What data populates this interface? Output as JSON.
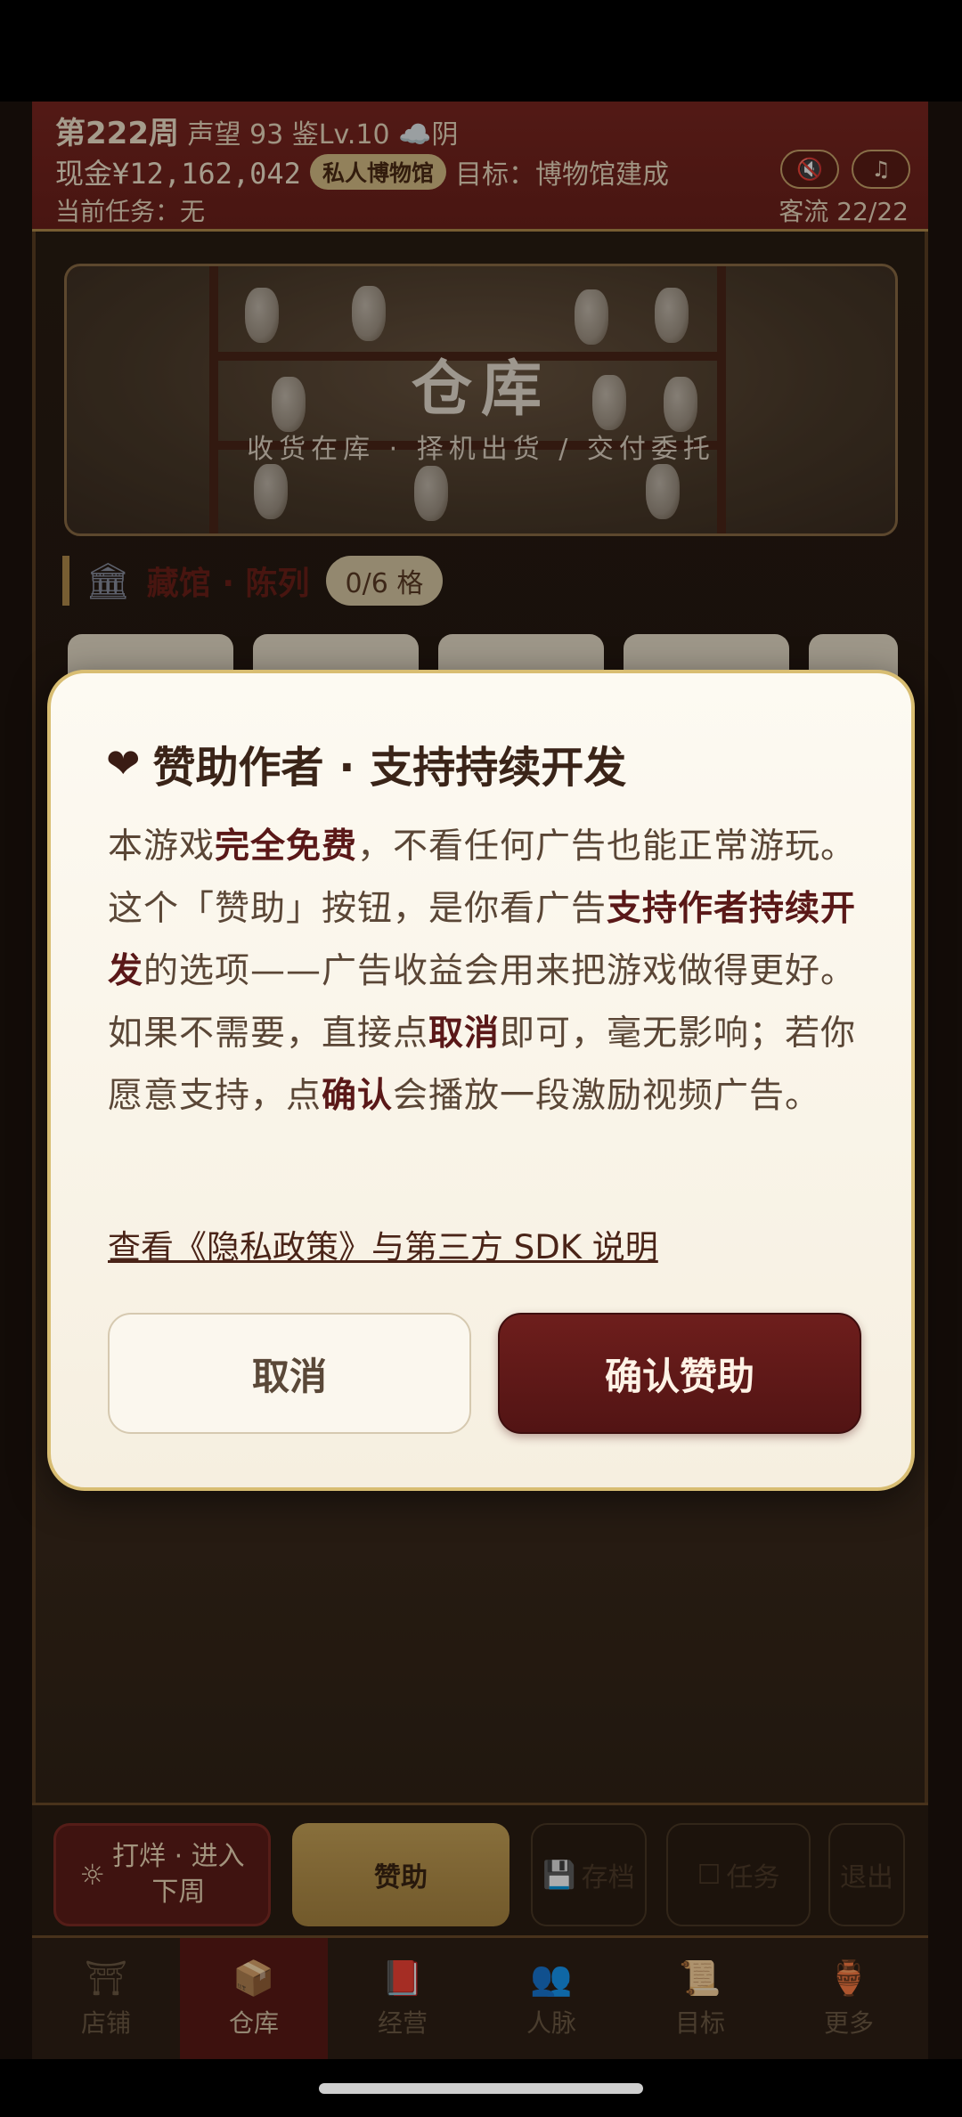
{
  "hud": {
    "week": "第222周",
    "prestige": "声望 93",
    "appraisal_level": "鉴Lv.10",
    "weather": "☁️阴",
    "cash": "现金¥12,162,042",
    "museum_badge": "私人博物馆",
    "goal": "目标：博物馆建成",
    "task": "当前任务：无",
    "visitors": "客流 22/22",
    "mute_icon": "speaker-mute-icon",
    "music_icon": "music-note-icon"
  },
  "banner": {
    "title": "仓库",
    "subtitle": "收货在库 · 择机出货 / 交付委托"
  },
  "section": {
    "title": "藏馆 · 陈列",
    "slots": "0/6 格"
  },
  "modal": {
    "title": "赞助作者 · 支持持续开发",
    "body": [
      {
        "t": "本游戏",
        "b": false
      },
      {
        "t": "完全免费",
        "b": true
      },
      {
        "t": "，不看任何广告也能正常游玩。这个「赞助」按钮，是你看广告",
        "b": false
      },
      {
        "t": "支持作者持续开发",
        "b": true
      },
      {
        "t": "的选项——广告收益会用来把游戏做得更好。如果不需要，直接点",
        "b": false
      },
      {
        "t": "取消",
        "b": true
      },
      {
        "t": "即可，毫无影响；若你愿意支持，点",
        "b": false
      },
      {
        "t": "确认",
        "b": true
      },
      {
        "t": "会播放一段激励视频广告。",
        "b": false
      }
    ],
    "privacy_link": "查看《隐私政策》与第三方 SDK 说明",
    "cancel_label": "取消",
    "confirm_label": "确认赞助"
  },
  "actions": {
    "proceed_line1": "打烊 · 进入",
    "proceed_line2": "下周",
    "sponsor": "赞助",
    "save": "存档",
    "tasks": "任务",
    "quit": "退出"
  },
  "tabs": [
    {
      "label": "店铺",
      "icon": "shop-icon",
      "glyph": "⛩"
    },
    {
      "label": "仓库",
      "icon": "warehouse-icon",
      "glyph": "📦"
    },
    {
      "label": "经营",
      "icon": "ledger-icon",
      "glyph": "📕"
    },
    {
      "label": "人脉",
      "icon": "people-icon",
      "glyph": "👥"
    },
    {
      "label": "目标",
      "icon": "goal-scroll-icon",
      "glyph": "📜"
    },
    {
      "label": "更多",
      "icon": "more-icon",
      "glyph": "🏺"
    }
  ],
  "active_tab": "仓库",
  "colors": {
    "accent_red": "#6b201a",
    "gold": "#c9a458",
    "modal_bg": "#fdfaf2"
  }
}
